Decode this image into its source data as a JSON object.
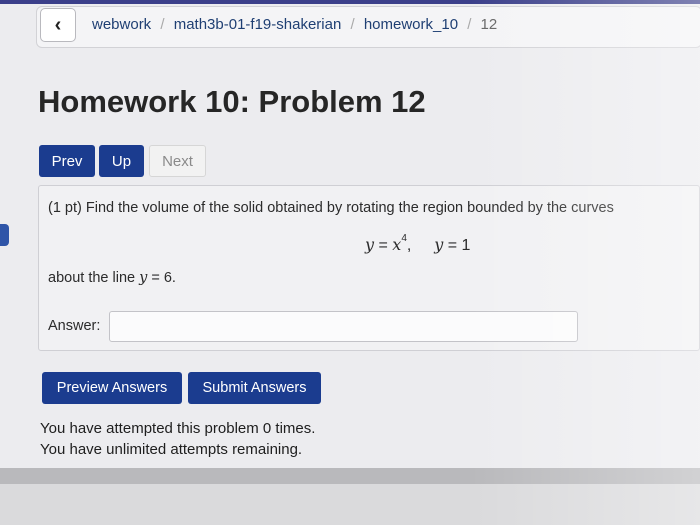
{
  "breadcrumb": {
    "back_icon": "chevron-left-icon",
    "items": [
      "webwork",
      "math3b-01-f19-shakerian",
      "homework_10",
      "12"
    ],
    "separator": "/"
  },
  "page_title": "Homework 10: Problem 12",
  "nav": {
    "prev": "Prev",
    "up": "Up",
    "next": "Next"
  },
  "problem": {
    "statement": "(1 pt) Find the volume of the solid obtained by rotating the region bounded by the curves",
    "eq1_lhs": "y",
    "eq1_rhs_base": "x",
    "eq1_exp": "4",
    "eq2_lhs": "y",
    "eq2_rhs": "1",
    "about_prefix": "about the line",
    "about_var": "y",
    "about_value": "6",
    "answer_label": "Answer:",
    "answer_value": ""
  },
  "actions": {
    "preview": "Preview Answers",
    "submit": "Submit Answers"
  },
  "status": {
    "attempted": "You have attempted this problem 0 times.",
    "remaining": "You have unlimited attempts remaining."
  },
  "colors": {
    "primary_button": "#1b3c8f",
    "link": "#1f3f73",
    "panel": "#f1f1f3"
  }
}
